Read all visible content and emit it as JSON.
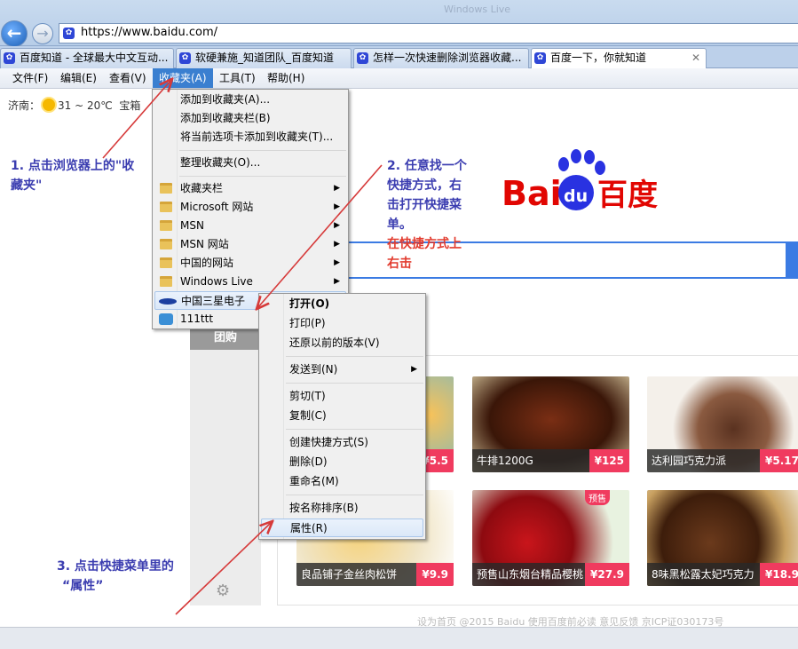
{
  "browser": {
    "url": "https://www.baidu.com/",
    "faded_title": "Windows Live",
    "tabs": [
      {
        "label": "百度知道 - 全球最大中文互动..."
      },
      {
        "label": "软硬兼施_知道团队_百度知道"
      },
      {
        "label": "怎样一次快速删除浏览器收藏..."
      },
      {
        "label": "百度一下，你就知道",
        "close": "✕",
        "active": true
      }
    ],
    "menubar": [
      "文件(F)",
      "编辑(E)",
      "查看(V)",
      "收藏夹(A)",
      "工具(T)",
      "帮助(H)"
    ],
    "menubar_selected": "收藏夹(A)"
  },
  "page": {
    "weather_city": "济南：",
    "weather_temp": "31 ~ 20℃",
    "weather_more": "宝箱",
    "logo_text_bai": "Bai",
    "logo_text_du": "du",
    "logo_text_cn": "百度",
    "tuangou": "团购",
    "footer": "设为首页 @2015 Baidu 使用百度前必读 意见反馈 京ICP证030173号",
    "products": [
      {
        "name": "",
        "price": "¥5.5"
      },
      {
        "name": "牛排1200G",
        "price": "¥125"
      },
      {
        "name": "达利园巧克力派",
        "price": "¥5.17"
      },
      {
        "name": "良品铺子金丝肉松饼",
        "price": "¥9.9"
      },
      {
        "name": "预售山东烟台精品樱桃",
        "price": "¥27.9",
        "badge": "预售"
      },
      {
        "name": "8味黑松露太妃巧克力",
        "price": "¥18.9"
      }
    ]
  },
  "favorites_menu": {
    "items": [
      {
        "label": "添加到收藏夹(A)..."
      },
      {
        "label": "添加到收藏夹栏(B)"
      },
      {
        "label": "将当前选项卡添加到收藏夹(T)..."
      },
      {
        "label": "整理收藏夹(O)..."
      },
      {
        "label": "收藏夹栏",
        "submenu": true
      },
      {
        "label": "Microsoft 网站",
        "submenu": true
      },
      {
        "label": "MSN",
        "submenu": true
      },
      {
        "label": "MSN 网站",
        "submenu": true
      },
      {
        "label": "中国的网站",
        "submenu": true
      },
      {
        "label": "Windows Live",
        "submenu": true
      },
      {
        "label": "中国三星电子",
        "highlighted": true
      },
      {
        "label": "111ttt"
      }
    ],
    "submenu_arrow": "▶"
  },
  "context_menu": {
    "items": [
      {
        "label": "打开(O)",
        "bold": true
      },
      {
        "label": "打印(P)"
      },
      {
        "label": "还原以前的版本(V)"
      },
      {
        "label": "发送到(N)",
        "submenu": true
      },
      {
        "label": "剪切(T)"
      },
      {
        "label": "复制(C)"
      },
      {
        "label": "创建快捷方式(S)"
      },
      {
        "label": "删除(D)"
      },
      {
        "label": "重命名(M)"
      },
      {
        "label": "按名称排序(B)"
      },
      {
        "label": "属性(R)",
        "highlighted": true
      }
    ]
  },
  "annotations": {
    "step1_line1": "1. 点击浏览器上的\"收",
    "step1_line2": "藏夹\"",
    "step2_line1": "2. 任意找一个",
    "step2_line2": "快捷方式，右",
    "step2_line3": "击打开快捷菜",
    "step2_line4": "单。",
    "step2_red1": "在快捷方式上",
    "step2_red2": "右击",
    "step3_line1": "3. 点击快捷菜单里的",
    "step3_line2": "“属性”"
  },
  "colors": {
    "accent": "#3a7fd0",
    "annotation_blue": "#3b3db0",
    "annotation_red": "#e23b2e",
    "baidu_red": "#e10602",
    "baidu_blue": "#2932e1",
    "price_red": "#f03b5f"
  },
  "icons": [
    "back-arrow-icon",
    "forward-arrow-icon",
    "baidu-paw-icon",
    "sun-icon",
    "folder-icon",
    "samsung-icon",
    "gear-icon"
  ]
}
